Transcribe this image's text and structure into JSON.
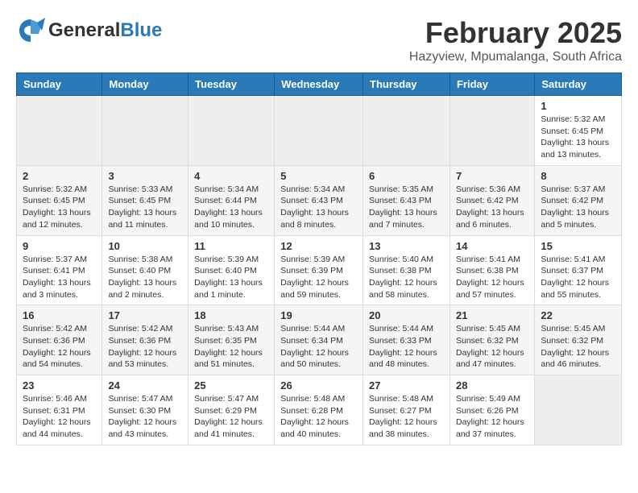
{
  "header": {
    "logo_general": "General",
    "logo_blue": "Blue",
    "title": "February 2025",
    "subtitle": "Hazyview, Mpumalanga, South Africa"
  },
  "weekdays": [
    "Sunday",
    "Monday",
    "Tuesday",
    "Wednesday",
    "Thursday",
    "Friday",
    "Saturday"
  ],
  "weeks": [
    [
      {
        "day": "",
        "info": ""
      },
      {
        "day": "",
        "info": ""
      },
      {
        "day": "",
        "info": ""
      },
      {
        "day": "",
        "info": ""
      },
      {
        "day": "",
        "info": ""
      },
      {
        "day": "",
        "info": ""
      },
      {
        "day": "1",
        "info": "Sunrise: 5:32 AM\nSunset: 6:45 PM\nDaylight: 13 hours\nand 13 minutes."
      }
    ],
    [
      {
        "day": "2",
        "info": "Sunrise: 5:32 AM\nSunset: 6:45 PM\nDaylight: 13 hours\nand 12 minutes."
      },
      {
        "day": "3",
        "info": "Sunrise: 5:33 AM\nSunset: 6:45 PM\nDaylight: 13 hours\nand 11 minutes."
      },
      {
        "day": "4",
        "info": "Sunrise: 5:34 AM\nSunset: 6:44 PM\nDaylight: 13 hours\nand 10 minutes."
      },
      {
        "day": "5",
        "info": "Sunrise: 5:34 AM\nSunset: 6:43 PM\nDaylight: 13 hours\nand 8 minutes."
      },
      {
        "day": "6",
        "info": "Sunrise: 5:35 AM\nSunset: 6:43 PM\nDaylight: 13 hours\nand 7 minutes."
      },
      {
        "day": "7",
        "info": "Sunrise: 5:36 AM\nSunset: 6:42 PM\nDaylight: 13 hours\nand 6 minutes."
      },
      {
        "day": "8",
        "info": "Sunrise: 5:37 AM\nSunset: 6:42 PM\nDaylight: 13 hours\nand 5 minutes."
      }
    ],
    [
      {
        "day": "9",
        "info": "Sunrise: 5:37 AM\nSunset: 6:41 PM\nDaylight: 13 hours\nand 3 minutes."
      },
      {
        "day": "10",
        "info": "Sunrise: 5:38 AM\nSunset: 6:40 PM\nDaylight: 13 hours\nand 2 minutes."
      },
      {
        "day": "11",
        "info": "Sunrise: 5:39 AM\nSunset: 6:40 PM\nDaylight: 13 hours\nand 1 minute."
      },
      {
        "day": "12",
        "info": "Sunrise: 5:39 AM\nSunset: 6:39 PM\nDaylight: 12 hours\nand 59 minutes."
      },
      {
        "day": "13",
        "info": "Sunrise: 5:40 AM\nSunset: 6:38 PM\nDaylight: 12 hours\nand 58 minutes."
      },
      {
        "day": "14",
        "info": "Sunrise: 5:41 AM\nSunset: 6:38 PM\nDaylight: 12 hours\nand 57 minutes."
      },
      {
        "day": "15",
        "info": "Sunrise: 5:41 AM\nSunset: 6:37 PM\nDaylight: 12 hours\nand 55 minutes."
      }
    ],
    [
      {
        "day": "16",
        "info": "Sunrise: 5:42 AM\nSunset: 6:36 PM\nDaylight: 12 hours\nand 54 minutes."
      },
      {
        "day": "17",
        "info": "Sunrise: 5:42 AM\nSunset: 6:36 PM\nDaylight: 12 hours\nand 53 minutes."
      },
      {
        "day": "18",
        "info": "Sunrise: 5:43 AM\nSunset: 6:35 PM\nDaylight: 12 hours\nand 51 minutes."
      },
      {
        "day": "19",
        "info": "Sunrise: 5:44 AM\nSunset: 6:34 PM\nDaylight: 12 hours\nand 50 minutes."
      },
      {
        "day": "20",
        "info": "Sunrise: 5:44 AM\nSunset: 6:33 PM\nDaylight: 12 hours\nand 48 minutes."
      },
      {
        "day": "21",
        "info": "Sunrise: 5:45 AM\nSunset: 6:32 PM\nDaylight: 12 hours\nand 47 minutes."
      },
      {
        "day": "22",
        "info": "Sunrise: 5:45 AM\nSunset: 6:32 PM\nDaylight: 12 hours\nand 46 minutes."
      }
    ],
    [
      {
        "day": "23",
        "info": "Sunrise: 5:46 AM\nSunset: 6:31 PM\nDaylight: 12 hours\nand 44 minutes."
      },
      {
        "day": "24",
        "info": "Sunrise: 5:47 AM\nSunset: 6:30 PM\nDaylight: 12 hours\nand 43 minutes."
      },
      {
        "day": "25",
        "info": "Sunrise: 5:47 AM\nSunset: 6:29 PM\nDaylight: 12 hours\nand 41 minutes."
      },
      {
        "day": "26",
        "info": "Sunrise: 5:48 AM\nSunset: 6:28 PM\nDaylight: 12 hours\nand 40 minutes."
      },
      {
        "day": "27",
        "info": "Sunrise: 5:48 AM\nSunset: 6:27 PM\nDaylight: 12 hours\nand 38 minutes."
      },
      {
        "day": "28",
        "info": "Sunrise: 5:49 AM\nSunset: 6:26 PM\nDaylight: 12 hours\nand 37 minutes."
      },
      {
        "day": "",
        "info": ""
      }
    ]
  ]
}
